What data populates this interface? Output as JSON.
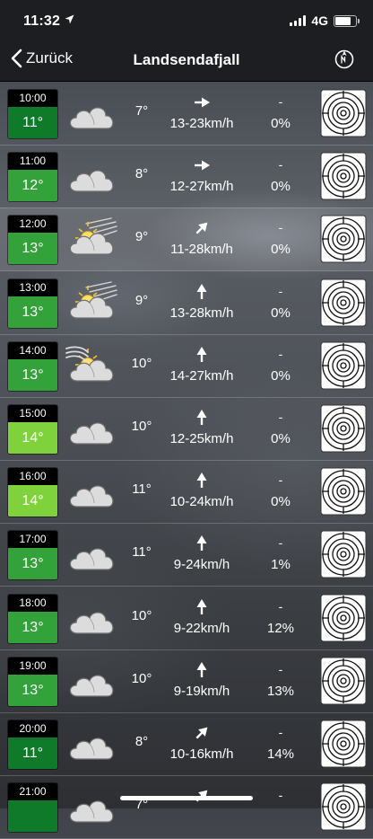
{
  "status": {
    "time": "11:32",
    "network": "4G",
    "location_icon": "location-arrow-icon"
  },
  "nav": {
    "back_label": "Zurück",
    "title": "Landsendafjall",
    "right_icon": "compass-icon"
  },
  "colors": {
    "dark_green": "#0e7a2a",
    "green": "#33a23a",
    "light_green": "#7fd23c"
  },
  "rows": [
    {
      "time": "10:00",
      "wind_temp": "11°",
      "color": "#0e7a2a",
      "icon": "cloud",
      "temp": "7°",
      "dir": 90,
      "wind": "13-23km/h",
      "precip_dash": "-",
      "precip": "0%"
    },
    {
      "time": "11:00",
      "wind_temp": "12°",
      "color": "#33a23a",
      "icon": "cloud",
      "temp": "8°",
      "dir": 90,
      "wind": "12-27km/h",
      "precip_dash": "-",
      "precip": "0%"
    },
    {
      "time": "12:00",
      "wind_temp": "13°",
      "color": "#33a23a",
      "icon": "sun-cloud-wind",
      "temp": "9°",
      "dir": 45,
      "wind": "11-28km/h",
      "precip_dash": "-",
      "precip": "0%"
    },
    {
      "time": "13:00",
      "wind_temp": "13°",
      "color": "#33a23a",
      "icon": "sun-cloud-wind",
      "temp": "9°",
      "dir": 0,
      "wind": "13-28km/h",
      "precip_dash": "-",
      "precip": "0%"
    },
    {
      "time": "14:00",
      "wind_temp": "13°",
      "color": "#33a23a",
      "icon": "sun-cloud-windy",
      "temp": "10°",
      "dir": 0,
      "wind": "14-27km/h",
      "precip_dash": "-",
      "precip": "0%"
    },
    {
      "time": "15:00",
      "wind_temp": "14°",
      "color": "#7fd23c",
      "icon": "cloud",
      "temp": "10°",
      "dir": 0,
      "wind": "12-25km/h",
      "precip_dash": "-",
      "precip": "0%"
    },
    {
      "time": "16:00",
      "wind_temp": "14°",
      "color": "#7fd23c",
      "icon": "cloud",
      "temp": "11°",
      "dir": 0,
      "wind": "10-24km/h",
      "precip_dash": "-",
      "precip": "0%"
    },
    {
      "time": "17:00",
      "wind_temp": "13°",
      "color": "#33a23a",
      "icon": "cloud",
      "temp": "11°",
      "dir": 0,
      "wind": "9-24km/h",
      "precip_dash": "-",
      "precip": "1%"
    },
    {
      "time": "18:00",
      "wind_temp": "13°",
      "color": "#33a23a",
      "icon": "cloud",
      "temp": "10°",
      "dir": 0,
      "wind": "9-22km/h",
      "precip_dash": "-",
      "precip": "12%"
    },
    {
      "time": "19:00",
      "wind_temp": "13°",
      "color": "#33a23a",
      "icon": "cloud",
      "temp": "10°",
      "dir": 0,
      "wind": "9-19km/h",
      "precip_dash": "-",
      "precip": "13%"
    },
    {
      "time": "20:00",
      "wind_temp": "11°",
      "color": "#0e7a2a",
      "icon": "cloud",
      "temp": "8°",
      "dir": 45,
      "wind": "10-16km/h",
      "precip_dash": "-",
      "precip": "14%"
    },
    {
      "time": "21:00",
      "wind_temp": "",
      "color": "#0e7a2a",
      "icon": "cloud",
      "temp": "7°",
      "dir": 45,
      "wind": "",
      "precip_dash": "-",
      "precip": ""
    }
  ]
}
